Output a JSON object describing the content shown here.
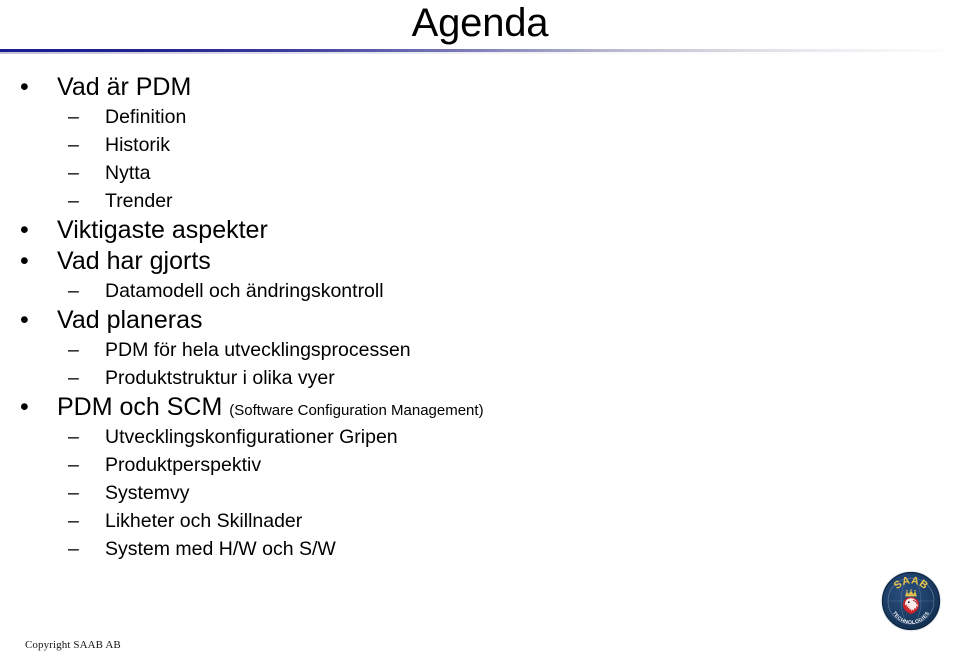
{
  "slide": {
    "title": "Agenda",
    "accent_color": "#1b1b8f",
    "background_color": "#ffffff",
    "text_color": "#000000"
  },
  "bullets": [
    {
      "level": 1,
      "marker": "•",
      "text": "Vad är PDM"
    },
    {
      "level": 2,
      "marker": "–",
      "text": "Definition"
    },
    {
      "level": 2,
      "marker": "–",
      "text": "Historik"
    },
    {
      "level": 2,
      "marker": "–",
      "text": "Nytta"
    },
    {
      "level": 2,
      "marker": "–",
      "text": "Trender"
    },
    {
      "level": 1,
      "marker": "•",
      "text": "Viktigaste aspekter"
    },
    {
      "level": 1,
      "marker": "•",
      "text": "Vad har gjorts"
    },
    {
      "level": 2,
      "marker": "–",
      "text": "Datamodell och ändringskontroll"
    },
    {
      "level": 1,
      "marker": "•",
      "text": "Vad planeras"
    },
    {
      "level": 2,
      "marker": "–",
      "text": "PDM för hela utvecklingsprocessen"
    },
    {
      "level": 2,
      "marker": "–",
      "text": "Produktstruktur i olika vyer"
    },
    {
      "level": 1,
      "marker": "•",
      "text": "PDM och SCM ",
      "suffix": "(Software Configuration Management)"
    },
    {
      "level": 2,
      "marker": "–",
      "text": "Utvecklingskonfigurationer Gripen"
    },
    {
      "level": 2,
      "marker": "–",
      "text": "Produktperspektiv"
    },
    {
      "level": 2,
      "marker": "–",
      "text": "Systemvy"
    },
    {
      "level": 2,
      "marker": "–",
      "text": "Likheter och Skillnader"
    },
    {
      "level": 2,
      "marker": "–",
      "text": "System med H/W och S/W"
    }
  ],
  "footer": {
    "copyright": "Copyright SAAB AB"
  },
  "logo": {
    "brand": "SAAB",
    "tagline": "TECHNOLOGIES",
    "ring_color": "#1b3a63",
    "brand_color": "#e8c34a",
    "griffin_color": "#cc2127"
  }
}
